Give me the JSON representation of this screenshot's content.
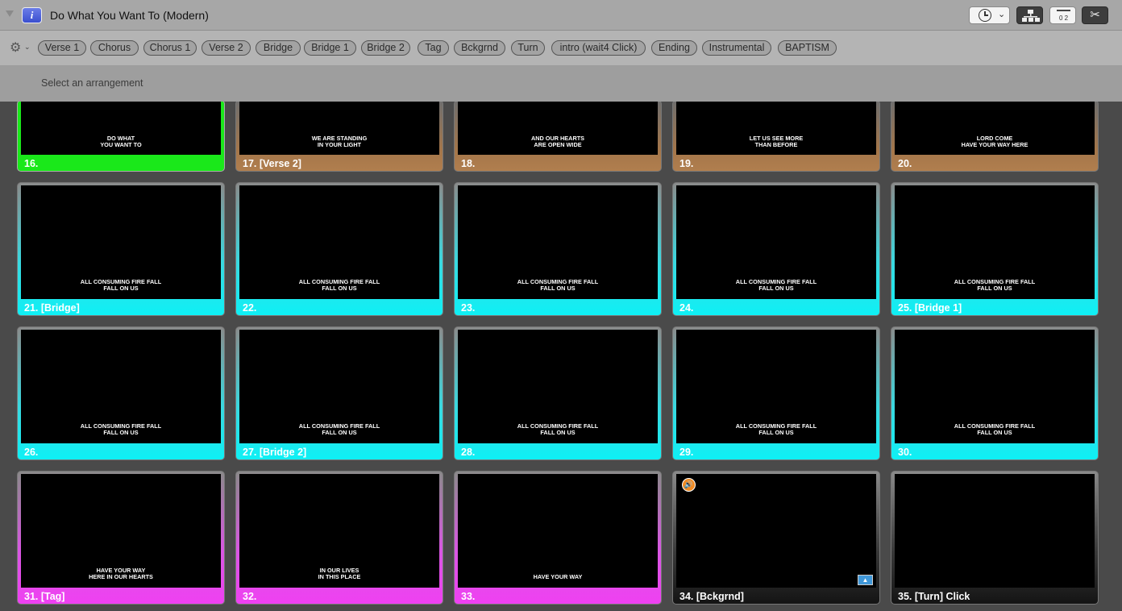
{
  "window": {
    "title": "Do What You Want To (Modern)"
  },
  "toolbar": {
    "info_glyph": "i",
    "clock_chevron": "⌄",
    "scissor_glyph": "✂",
    "counter_text": "0 2"
  },
  "groups": [
    "Verse 1",
    "Chorus",
    "Chorus 1",
    "Verse 2",
    "Bridge",
    "Bridge 1",
    "Bridge 2",
    "Tag",
    "Bckgrnd",
    "Turn",
    "intro (wait4 Click)",
    "Ending",
    "Instrumental",
    "BAPTISM"
  ],
  "arrangement": {
    "placeholder": "Select an arrangement"
  },
  "slides": [
    {
      "label": "16.",
      "lines": [
        "DO WHAT",
        "YOU WANT TO"
      ],
      "color": "#1ae81a"
    },
    {
      "label": "17. [Verse 2]",
      "lines": [
        "WE ARE STANDING",
        "IN YOUR LIGHT"
      ],
      "color": "#b07e4e"
    },
    {
      "label": "18.",
      "lines": [
        "AND OUR HEARTS",
        "ARE OPEN WIDE"
      ],
      "color": "#b07e4e"
    },
    {
      "label": "19.",
      "lines": [
        "LET US SEE MORE",
        "THAN BEFORE"
      ],
      "color": "#b07e4e"
    },
    {
      "label": "20.",
      "lines": [
        "LORD COME",
        "HAVE YOUR WAY HERE"
      ],
      "color": "#b07e4e"
    },
    {
      "label": "21. [Bridge]",
      "lines": [
        "ALL CONSUMING FIRE FALL",
        "FALL ON US"
      ],
      "color": "#0ef0f5"
    },
    {
      "label": "22.",
      "lines": [
        "ALL CONSUMING FIRE FALL",
        "FALL ON US"
      ],
      "color": "#0ef0f5"
    },
    {
      "label": "23.",
      "lines": [
        "ALL CONSUMING FIRE FALL",
        "FALL ON US"
      ],
      "color": "#0ef0f5"
    },
    {
      "label": "24.",
      "lines": [
        "ALL CONSUMING FIRE FALL",
        "FALL ON US"
      ],
      "color": "#0ef0f5"
    },
    {
      "label": "25. [Bridge 1]",
      "lines": [
        "ALL CONSUMING FIRE FALL",
        "FALL ON US"
      ],
      "color": "#0ef0f5"
    },
    {
      "label": "26.",
      "lines": [
        "ALL CONSUMING FIRE FALL",
        "FALL ON US"
      ],
      "color": "#0ef0f5"
    },
    {
      "label": "27. [Bridge 2]",
      "lines": [
        "ALL CONSUMING FIRE FALL",
        "FALL ON US"
      ],
      "color": "#0ef0f5"
    },
    {
      "label": "28.",
      "lines": [
        "ALL CONSUMING FIRE FALL",
        "FALL ON US"
      ],
      "color": "#0ef0f5"
    },
    {
      "label": "29.",
      "lines": [
        "ALL CONSUMING FIRE FALL",
        "FALL ON US"
      ],
      "color": "#0ef0f5"
    },
    {
      "label": "30.",
      "lines": [
        "ALL CONSUMING FIRE FALL",
        "FALL ON US"
      ],
      "color": "#0ef0f5"
    },
    {
      "label": "31. [Tag]",
      "lines": [
        "HAVE YOUR WAY",
        "HERE IN OUR HEARTS"
      ],
      "color": "#ef40f2"
    },
    {
      "label": "32.",
      "lines": [
        "IN OUR LIVES",
        "IN THIS PLACE"
      ],
      "color": "#ef40f2"
    },
    {
      "label": "33.",
      "lines": [
        "HAVE YOUR WAY"
      ],
      "color": "#ef40f2"
    },
    {
      "label": "34. [Bckgrnd]",
      "lines": [],
      "color": "#141414",
      "cue_icon": "audio-cue-icon",
      "media_icon": "background-media-icon"
    },
    {
      "label": "35. [Turn] Click",
      "lines": [],
      "color": "#141414"
    }
  ]
}
